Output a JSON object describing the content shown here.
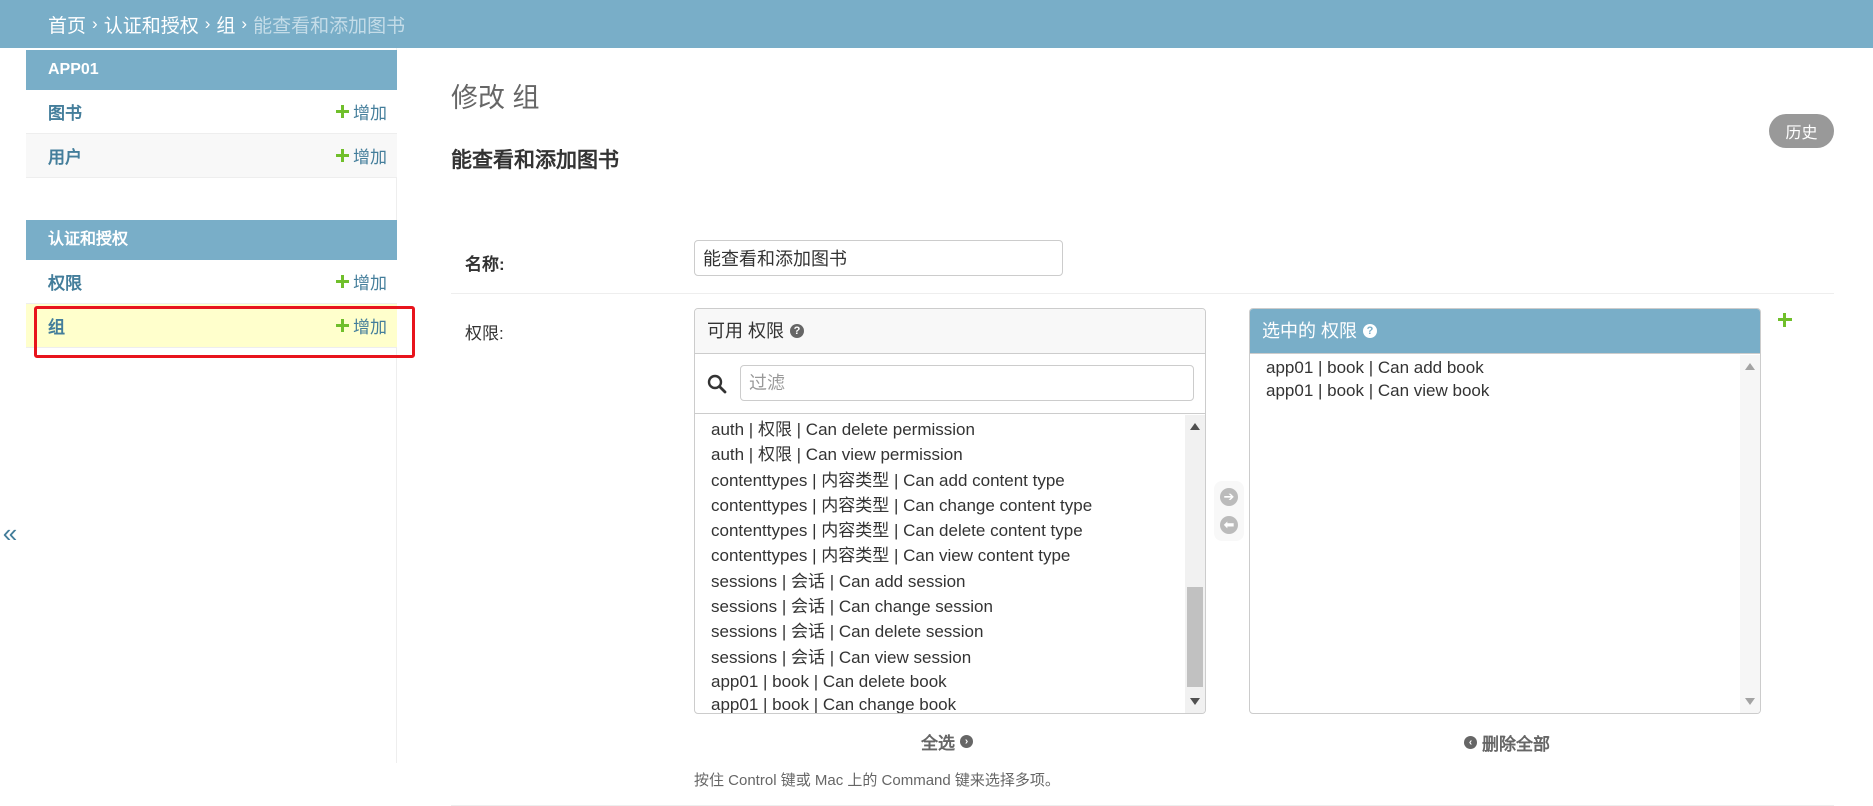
{
  "breadcrumb": {
    "home": "首页",
    "app": "认证和授权",
    "model": "组",
    "current": "能查看和添加图书"
  },
  "sidebar": {
    "modules": [
      {
        "caption": "APP01",
        "items": [
          {
            "label": "图书",
            "add": "增加"
          },
          {
            "label": "用户",
            "add": "增加"
          }
        ]
      },
      {
        "caption": "认证和授权",
        "items": [
          {
            "label": "权限",
            "add": "增加"
          },
          {
            "label": "组",
            "add": "增加",
            "selected": true
          }
        ]
      }
    ],
    "collapse_glyph": "«"
  },
  "main": {
    "heading": "修改 组",
    "object_title": "能查看和添加图书",
    "history_label": "历史",
    "name_field": {
      "label": "名称:",
      "value": "能查看和添加图书"
    },
    "permissions_field": {
      "label": "权限:",
      "available": {
        "title": "可用 权限",
        "filter_placeholder": "过滤",
        "options": [
          "auth | 权限 | Can delete permission",
          "auth | 权限 | Can view permission",
          "contenttypes | 内容类型 | Can add content type",
          "contenttypes | 内容类型 | Can change content type",
          "contenttypes | 内容类型 | Can delete content type",
          "contenttypes | 内容类型 | Can view content type",
          "sessions | 会话 | Can add session",
          "sessions | 会话 | Can change session",
          "sessions | 会话 | Can delete session",
          "sessions | 会话 | Can view session",
          "app01 | book | Can delete book",
          "app01 | book | Can change book"
        ],
        "choose_all": "全选"
      },
      "chosen": {
        "title": "选中的 权限",
        "options": [
          "app01 | book | Can add book",
          "app01 | book | Can view book"
        ],
        "clear_all": "删除全部"
      },
      "help_text": "按住 Control 键或 Mac 上的 Command 键来选择多项。"
    }
  },
  "colors": {
    "header_bg": "#79aec8",
    "link": "#447e9b",
    "add_icon": "#70bf2b",
    "selected_row": "#ffffcc",
    "highlight_box": "#e8141c"
  },
  "icons": {
    "add": "plus-icon",
    "help": "question-circle-icon",
    "search": "search-icon",
    "move_right": "arrow-right-circle-icon",
    "move_left": "arrow-left-circle-icon",
    "add_related": "plus-icon"
  }
}
